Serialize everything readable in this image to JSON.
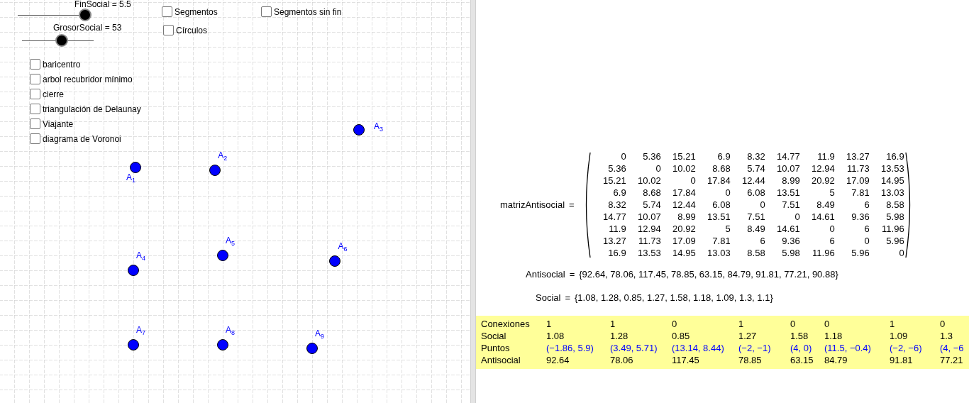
{
  "sliders": [
    {
      "label": "FinSocial = 5.5",
      "level": 0.95
    },
    {
      "label": "GrosorSocial = 53",
      "level": 0.55
    }
  ],
  "top_checkboxes": [
    {
      "label": "Segmentos",
      "checked": false
    },
    {
      "label": "Segmentos sin fin",
      "checked": false
    },
    {
      "label": "Círculos",
      "checked": false
    }
  ],
  "checkboxes": [
    {
      "label": "baricentro",
      "checked": false
    },
    {
      "label": "arbol recubridor mínimo",
      "checked": false
    },
    {
      "label": "cierre",
      "checked": false
    },
    {
      "label": "triangulación de Delaunay",
      "checked": false
    },
    {
      "label": "Viajante",
      "checked": false
    },
    {
      "label": "diagrama de Voronoi",
      "checked": false
    }
  ],
  "points": [
    {
      "label": "A$_{1}$"
    },
    {
      "label": "A$_{2}$"
    },
    {
      "label": "A$_{3}$"
    },
    {
      "label": "A$_{4}$"
    },
    {
      "label": "A$_{5}$"
    },
    {
      "label": "A$_{6}$"
    },
    {
      "label": "A$_{7}$"
    },
    {
      "label": "A$_{8}$"
    },
    {
      "label": "A$_{9}$"
    }
  ],
  "matrix": {
    "name": "matrizAntisocial",
    "equals": "=",
    "rows": [
      [
        "0",
        "5.36",
        "15.21",
        "6.9",
        "8.32",
        "14.77",
        "11.9",
        "13.27",
        "16.9"
      ],
      [
        "5.36",
        "0",
        "10.02",
        "8.68",
        "5.74",
        "10.07",
        "12.94",
        "11.73",
        "13.53"
      ],
      [
        "15.21",
        "10.02",
        "0",
        "17.84",
        "12.44",
        "8.99",
        "20.92",
        "17.09",
        "14.95"
      ],
      [
        "6.9",
        "8.68",
        "17.84",
        "0",
        "6.08",
        "13.51",
        "5",
        "7.81",
        "13.03"
      ],
      [
        "8.32",
        "5.74",
        "12.44",
        "6.08",
        "0",
        "7.51",
        "8.49",
        "6",
        "8.58"
      ],
      [
        "14.77",
        "10.07",
        "8.99",
        "13.51",
        "7.51",
        "0",
        "14.61",
        "9.36",
        "5.98"
      ],
      [
        "11.9",
        "12.94",
        "20.92",
        "5",
        "8.49",
        "14.61",
        "0",
        "6",
        "11.96"
      ],
      [
        "13.27",
        "11.73",
        "17.09",
        "7.81",
        "6",
        "9.36",
        "6",
        "0",
        "5.96"
      ],
      [
        "16.9",
        "13.53",
        "14.95",
        "13.03",
        "8.58",
        "5.98",
        "11.96",
        "5.96",
        "0"
      ]
    ]
  },
  "lists": [
    {
      "name": "Antisocial",
      "equals": "=",
      "value": "{92.64, 78.06, 117.45, 78.85, 63.15, 84.79, 91.81, 77.21, 90.88}"
    },
    {
      "name": "Social",
      "equals": "=",
      "value": "{1.08, 1.28, 0.85, 1.27, 1.58, 1.18, 1.09, 1.3, 1.1}"
    }
  ],
  "table": {
    "rows": [
      {
        "kind": "number",
        "header": "Conexiones",
        "cells": [
          "1",
          "1",
          "0",
          "1",
          "0",
          "0",
          "1",
          "0"
        ]
      },
      {
        "kind": "number",
        "header": "Social",
        "cells": [
          "1.08",
          "1.28",
          "0.85",
          "1.27",
          "1.58",
          "1.18",
          "1.09",
          "1.3"
        ]
      },
      {
        "kind": "point",
        "header": "Puntos",
        "cells": [
          "(−1.86, 5.9)",
          "(3.49, 5.71)",
          "(13.14, 8.44)",
          "(−2, −1)",
          "(4, 0)",
          "(11.5, −0.4)",
          "(−2, −6)",
          "(4, −6"
        ]
      },
      {
        "kind": "number",
        "header": "Antisocial",
        "cells": [
          "92.64",
          "78.06",
          "117.45",
          "78.85",
          "63.15",
          "84.79",
          "91.81",
          "77.21"
        ]
      }
    ]
  }
}
